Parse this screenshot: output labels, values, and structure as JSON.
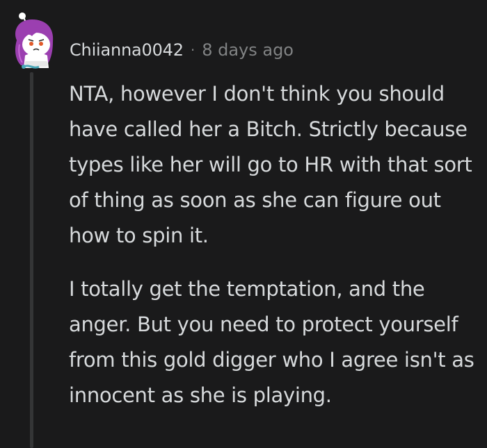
{
  "comment": {
    "author": "Chiianna0042",
    "separator": "·",
    "timestamp": "8 days ago",
    "avatar_icon": "snoo-avatar-purple-hair",
    "paragraphs": [
      "NTA, however I don't think you should have called her a Bitch. Strictly because types like her will go to HR with that sort of thing as soon as she can figure out how to spin it.",
      "I totally get the temptation, and the anger. But you need to protect yourself from this gold digger who I agree isn't as innocent as she is playing."
    ]
  },
  "colors": {
    "background": "#1a1a1b",
    "text": "#d7dadc",
    "meta": "#818384",
    "thread_line": "#343536",
    "avatar_hair": "#9b3fb0"
  }
}
